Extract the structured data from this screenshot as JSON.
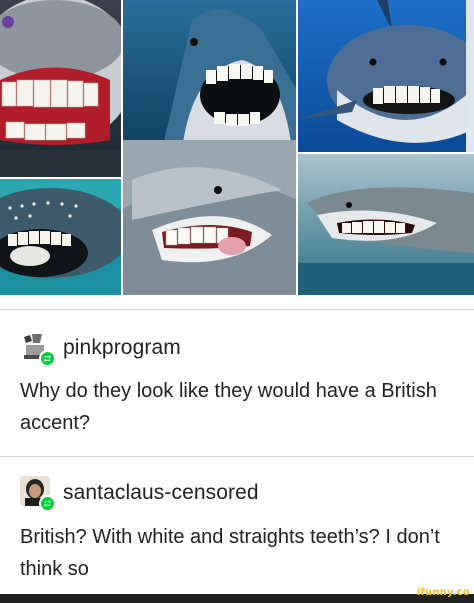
{
  "collage": {
    "tiles": [
      {
        "subject": "shark with human teeth, smiling"
      },
      {
        "subject": "shark with human teeth, mouth open"
      },
      {
        "subject": "shark with human teeth, grinning"
      },
      {
        "subject": "whale shark with human teeth"
      },
      {
        "subject": "great white with human teeth and tongue"
      },
      {
        "subject": "shark with human teeth, side view"
      }
    ]
  },
  "posts": [
    {
      "username": "pinkprogram",
      "text": "Why do they look like they would have a British accent?",
      "badge_icon": "reblog-icon",
      "badge_color": "#00cf35"
    },
    {
      "username": "santaclaus-censored",
      "text": "British? With white and straights teeth’s? I don’t think so",
      "badge_icon": "reblog-icon",
      "badge_color": "#00cf35"
    }
  ],
  "footer": {
    "watermark": "ifunny.co"
  }
}
